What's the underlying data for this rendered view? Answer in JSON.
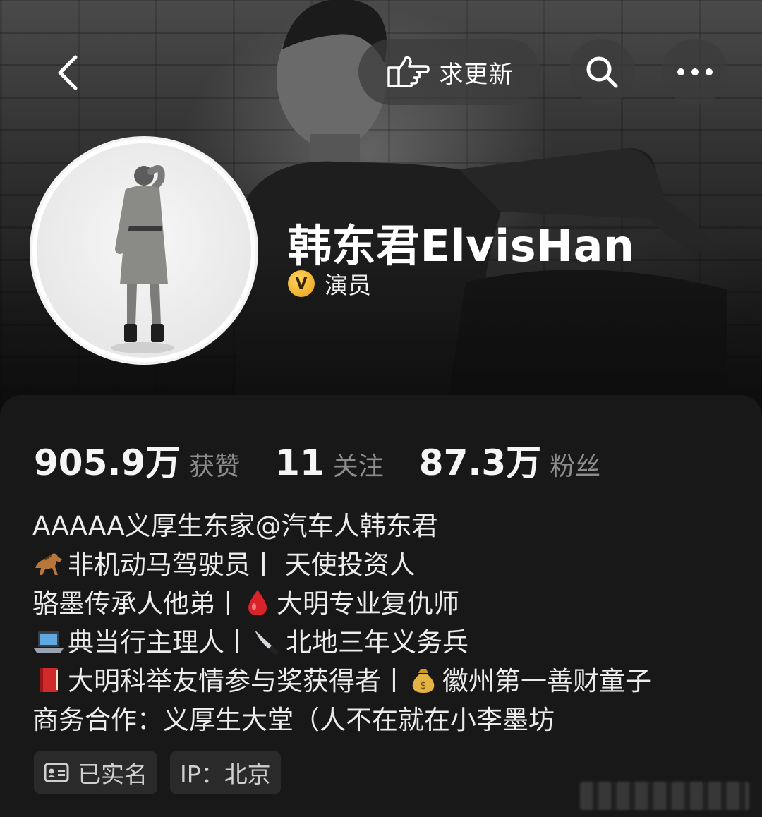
{
  "topbar": {
    "back_icon": "chevron-left-icon",
    "update_button": {
      "icon": "pointing-hand-icon",
      "label": "求更新"
    },
    "search_icon": "search-icon",
    "more_icon": "more-dots-icon"
  },
  "profile": {
    "name": "韩东君ElvisHan",
    "verified_badge": "V",
    "verified_label": "演员",
    "badge_color": "#f2b233"
  },
  "stats": [
    {
      "value": "905.9万",
      "label": "获赞"
    },
    {
      "value": "11",
      "label": "关注"
    },
    {
      "value": "87.3万",
      "label": "粉丝"
    }
  ],
  "bio": {
    "line1": "AAAAA义厚生东家@汽车人韩东君",
    "line2_emoji": "horse-emoji",
    "line2": "非机动马驾驶员丨   天使投资人",
    "line3": "   骆墨传承人他弟丨",
    "line3_emoji": "blood-drop-emoji",
    "line3b": "大明专业复仇师",
    "line4_emoji": "laptop-emoji",
    "line4": "典当行主理人丨",
    "line4_emoji2": "knife-emoji",
    "line4b": "北地三年义务兵",
    "line5_emoji": "red-book-emoji",
    "line5": "大明科举友情参与奖获得者丨",
    "line5_emoji2": "money-bag-emoji",
    "line5b": "徽州第一善财童子",
    "line6": "商务合作：义厚生大堂（人不在就在小李墨坊"
  },
  "tags": [
    {
      "icon": "id-card-icon",
      "label": "已实名"
    },
    {
      "label": "IP：北京"
    }
  ]
}
